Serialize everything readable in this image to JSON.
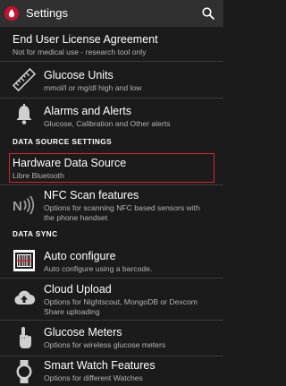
{
  "appbar": {
    "title": "Settings"
  },
  "items": {
    "eula": {
      "title": "End User License Agreement",
      "summary": "Not for medical use - research tool only"
    },
    "glucose_units": {
      "title": "Glucose Units",
      "summary": "mmol/l or mg/dl high and low"
    },
    "alarms": {
      "title": "Alarms and Alerts",
      "summary": "Glucose, Calibration and Other alerts"
    },
    "hardware_source": {
      "title": "Hardware Data Source",
      "summary": "Libre Bluetooth"
    },
    "nfc_scan": {
      "title": "NFC Scan features",
      "summary_line1": "Options for scanning NFC based sensors with",
      "summary_line2": "the phone handset"
    },
    "auto_configure": {
      "title": "Auto configure",
      "summary": "Auto configure using a barcode."
    },
    "cloud_upload": {
      "title": "Cloud Upload",
      "summary_line1": "Options for Nightscout, MongoDB or Dexcom",
      "summary_line2": "Share uploading"
    },
    "glucose_meters": {
      "title": "Glucose Meters",
      "summary": "Options for wireless glucose meters"
    },
    "smart_watch": {
      "title": "Smart Watch Features",
      "summary": "Options for different Watches"
    }
  },
  "categories": {
    "data_source": "DATA SOURCE SETTINGS",
    "data_sync": "DATA SYNC"
  },
  "colors": {
    "background": "#1b1b1b",
    "appbar": "#303030",
    "highlight_border": "#d9232d",
    "logo": "#c8102e",
    "summary_text": "#b4b4b4"
  },
  "icons": {
    "app_logo": "blood-drop-icon",
    "search": "search-icon",
    "glucose_units": "ruler-icon",
    "alarms": "bell-icon",
    "nfc_scan": "nfc-icon",
    "auto_configure": "barcode-icon",
    "cloud_upload": "cloud-upload-icon",
    "glucose_meters": "tap-hand-icon",
    "smart_watch": "smartwatch-icon"
  }
}
